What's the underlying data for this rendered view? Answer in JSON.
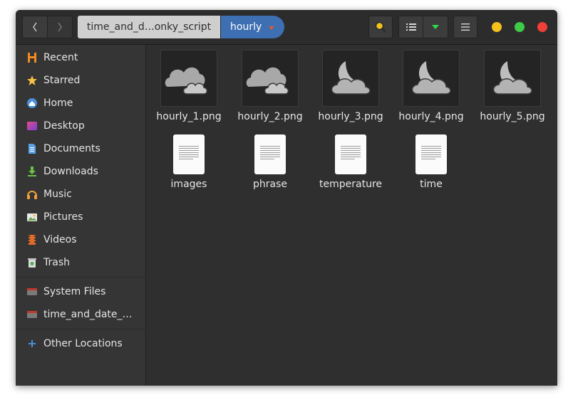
{
  "header": {
    "back_icon": "chevron-left-icon",
    "forward_icon": "chevron-right-icon",
    "breadcrumb_parent": "time_and_d…onky_script",
    "breadcrumb_current": "hourly",
    "search_icon": "search-icon",
    "view_icon": "list-view-icon",
    "view_options_icon": "caret-down-icon",
    "menu_icon": "hamburger-menu-icon",
    "window_controls": {
      "minimize_color": "#f4c11d",
      "maximize_color": "#3ec947",
      "close_color": "#ef3f37"
    }
  },
  "sidebar": {
    "items": [
      {
        "label": "Recent",
        "icon": "recent-icon"
      },
      {
        "label": "Starred",
        "icon": "star-icon"
      },
      {
        "label": "Home",
        "icon": "home-icon"
      },
      {
        "label": "Desktop",
        "icon": "desktop-icon"
      },
      {
        "label": "Documents",
        "icon": "documents-icon"
      },
      {
        "label": "Downloads",
        "icon": "downloads-icon"
      },
      {
        "label": "Music",
        "icon": "music-icon"
      },
      {
        "label": "Pictures",
        "icon": "pictures-icon"
      },
      {
        "label": "Videos",
        "icon": "videos-icon"
      },
      {
        "label": "Trash",
        "icon": "trash-icon"
      }
    ],
    "devices": [
      {
        "label": "System Files",
        "icon": "drive-icon"
      },
      {
        "label": "time_and_date_…",
        "icon": "drive-icon"
      }
    ],
    "other": {
      "label": "Other Locations",
      "icon": "plus-icon"
    }
  },
  "files": [
    {
      "name": "hourly_1.png",
      "thumb": "cloud-icon"
    },
    {
      "name": "hourly_2.png",
      "thumb": "cloud-icon"
    },
    {
      "name": "hourly_3.png",
      "thumb": "moon-cloud-icon"
    },
    {
      "name": "hourly_4.png",
      "thumb": "moon-cloud-icon"
    },
    {
      "name": "hourly_5.png",
      "thumb": "moon-cloud-icon"
    },
    {
      "name": "images",
      "thumb": "text-file-icon"
    },
    {
      "name": "phrase",
      "thumb": "text-file-icon"
    },
    {
      "name": "temperature",
      "thumb": "text-file-icon"
    },
    {
      "name": "time",
      "thumb": "text-file-icon"
    }
  ]
}
